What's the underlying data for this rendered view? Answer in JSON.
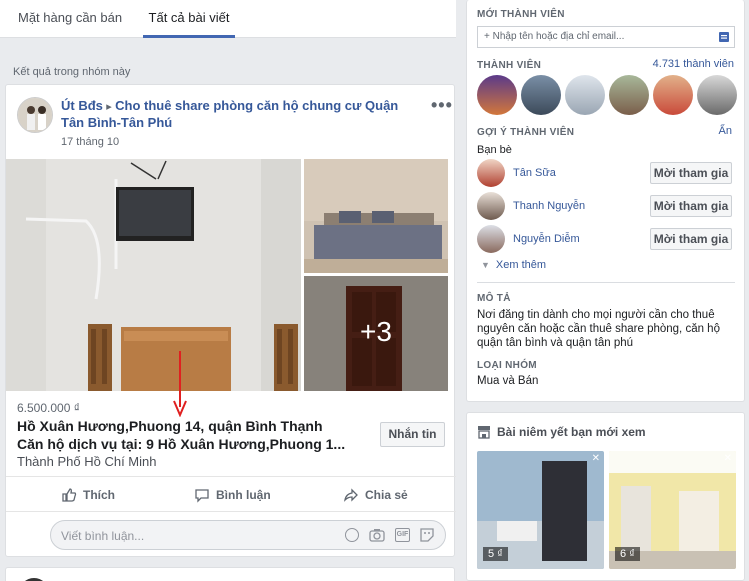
{
  "tabs": [
    {
      "label": "Mặt hàng cần bán",
      "active": false
    },
    {
      "label": "Tất cả bài viết",
      "active": true
    }
  ],
  "results_label": "Kết quả trong nhóm này",
  "post": {
    "author": "Út Bđs",
    "arrow": "▸",
    "group": "Cho thuê share phòng căn hộ chung cư Quận Tân Bình-Tân Phú",
    "date": "17 tháng 10",
    "more_photos": "+3",
    "price": "6.500.000 ₫",
    "title_line1": "Hồ Xuân Hương,Phuong 14, quận Bình Thạnh",
    "title_line2": "Căn hộ dịch vụ tại: 9 Hồ Xuân Hương,Phuong 1...",
    "location": "Thành Phố Hồ Chí Minh",
    "message_button": "Nhắn tin",
    "actions": {
      "like": "Thích",
      "comment": "Bình luận",
      "share": "Chia sẻ"
    },
    "comment_placeholder": "Viết bình luận...",
    "comment_gif": "GIF"
  },
  "sidebar": {
    "new_members_title": "MỚI THÀNH VIÊN",
    "invite_placeholder": "+ Nhập tên hoặc địa chỉ email...",
    "members_title": "THÀNH VIÊN",
    "members_count": "4.731 thành viên",
    "suggested_title": "GỢI Ý THÀNH VIÊN",
    "hide_label": "Ẩn",
    "friends_label": "Bạn bè",
    "suggestions": [
      {
        "name": "Tân Sữa",
        "button": "Mời tham gia"
      },
      {
        "name": "Thanh Nguyễn",
        "button": "Mời tham gia"
      },
      {
        "name": "Nguyễn Diễm",
        "button": "Mời tham gia"
      }
    ],
    "see_more": "Xem thêm",
    "description_title": "MÔ TẢ",
    "description": "Nơi đăng tin dành cho mọi người cần cho thuê nguyên căn hoặc cần thuê share phòng, căn hộ quận tân bình và quận tân phú",
    "group_type_title": "LOẠI NHÓM",
    "group_type": "Mua và Bán",
    "recent_listings_title": "Bài niêm yết bạn mới xem",
    "listings": [
      {
        "price": "5 ₫"
      },
      {
        "price": "6 ₫"
      }
    ]
  },
  "colors": {
    "accent": "#4267b2",
    "link": "#365899",
    "arrow_annotation": "#e02020"
  }
}
